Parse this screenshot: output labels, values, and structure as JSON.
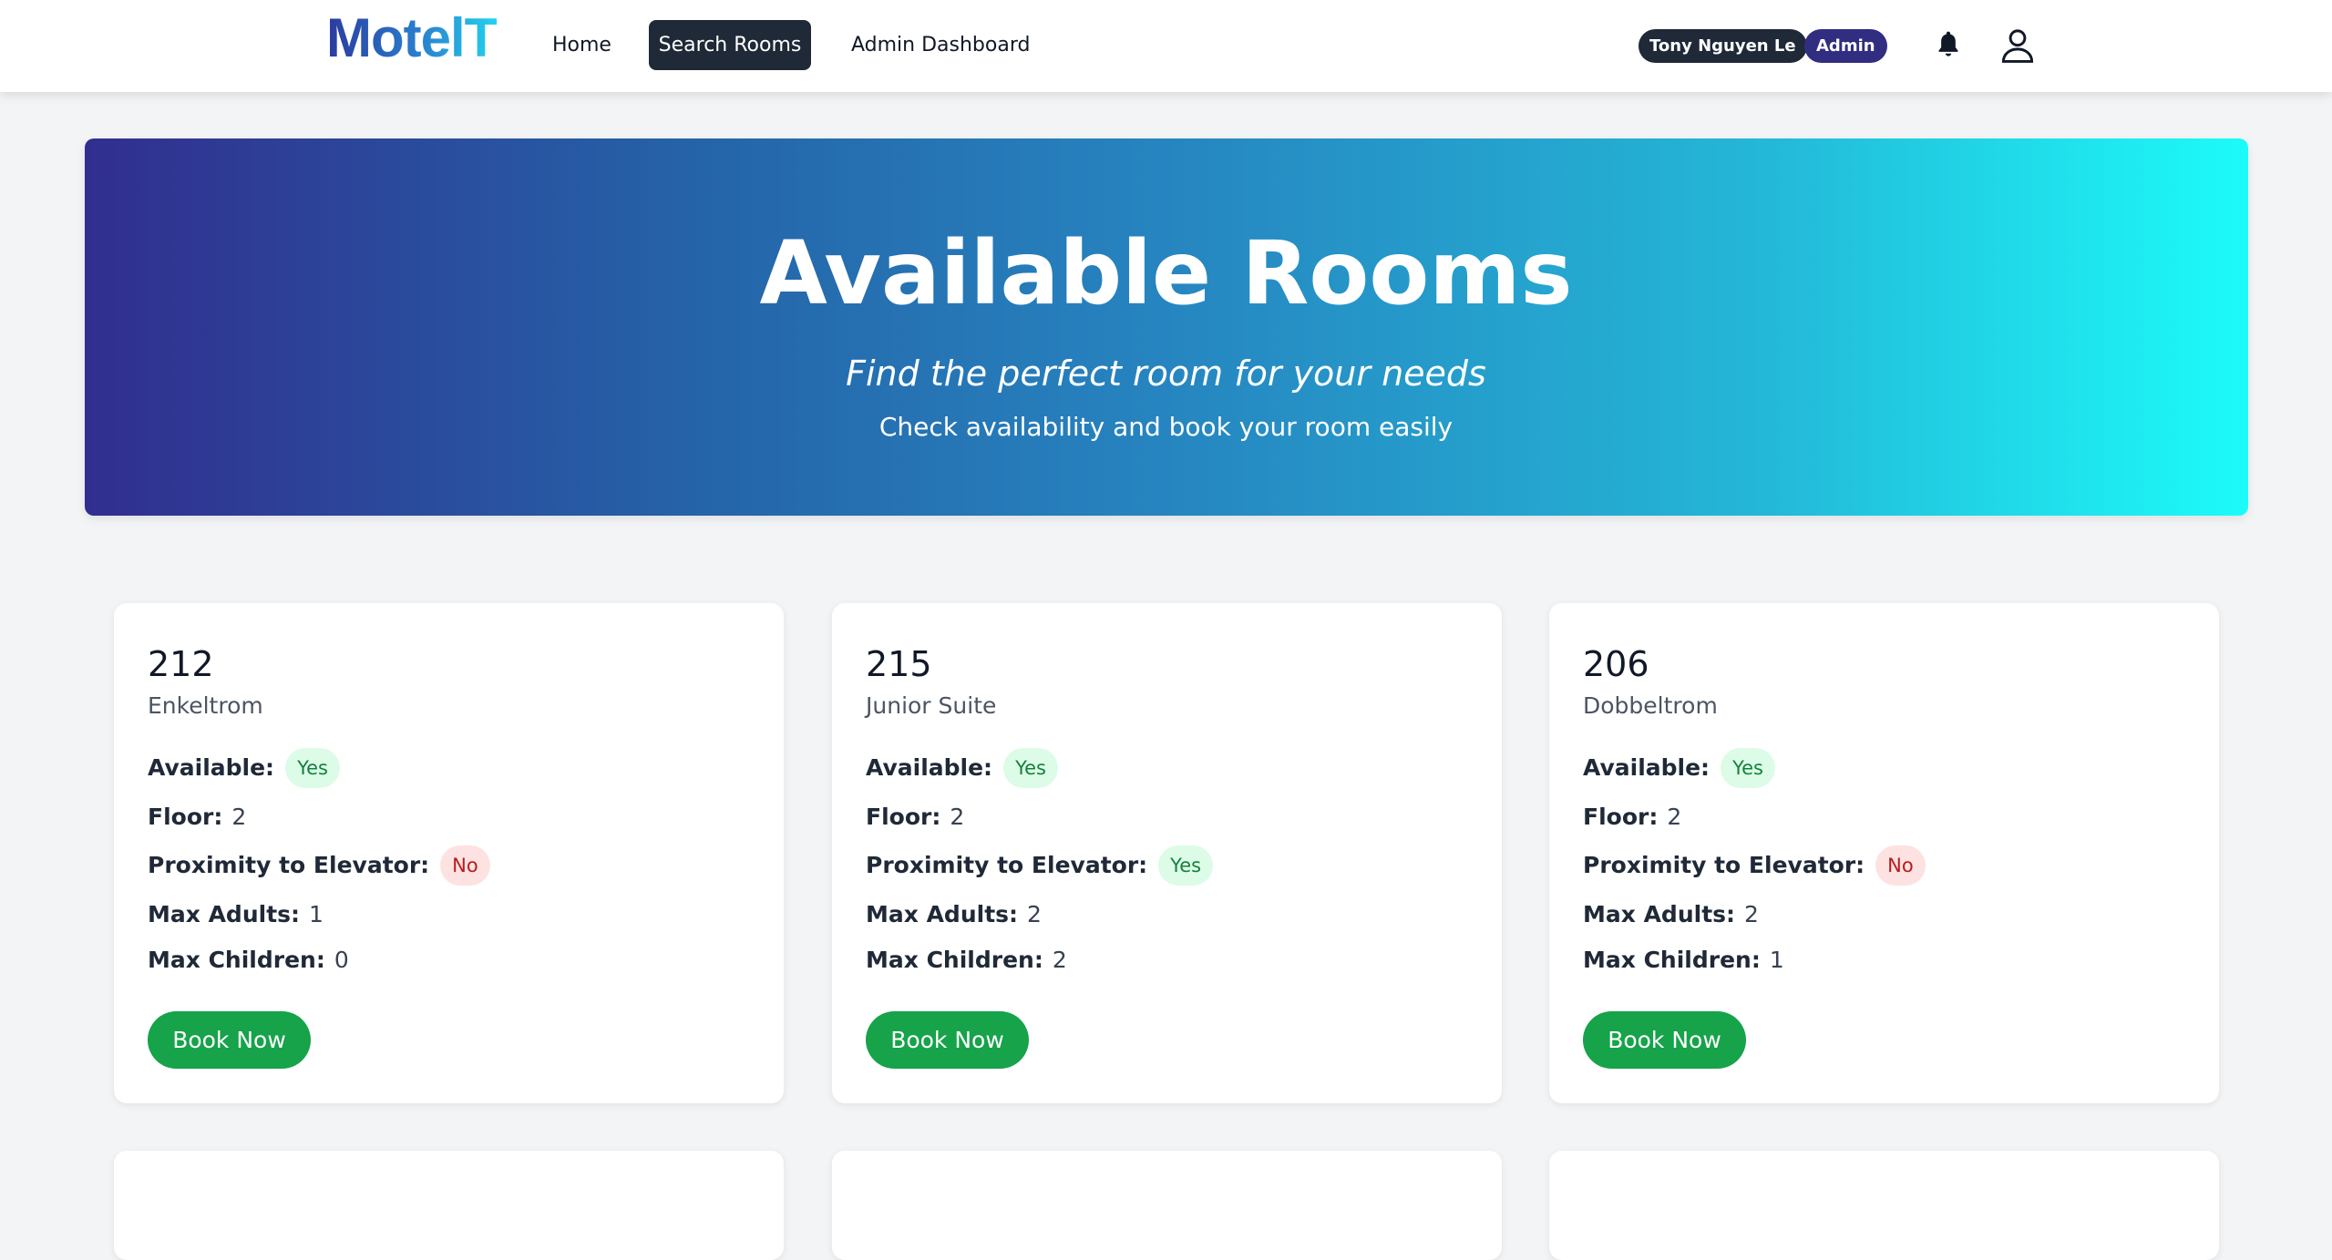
{
  "nav": {
    "logo": "MotelT",
    "home": "Home",
    "search_rooms": "Search Rooms",
    "admin_dashboard": "Admin Dashboard",
    "user_name": "Tony Nguyen Le",
    "role": "Admin",
    "notification_icon": "bell-icon",
    "profile_icon": "user-icon"
  },
  "hero": {
    "title": "Available Rooms",
    "subtitle": "Find the perfect room for your needs",
    "text": "Check availability and book your room easily"
  },
  "labels": {
    "available": "Available:",
    "floor": "Floor:",
    "elevator": "Proximity to Elevator:",
    "max_adults": "Max Adults:",
    "max_children": "Max Children:",
    "book": "Book Now"
  },
  "rooms": [
    {
      "number": "212",
      "type": "Enkeltrom",
      "available": "Yes",
      "floor": "2",
      "elevator": "No",
      "max_adults": "1",
      "max_children": "0"
    },
    {
      "number": "215",
      "type": "Junior Suite",
      "available": "Yes",
      "floor": "2",
      "elevator": "Yes",
      "max_adults": "2",
      "max_children": "2"
    },
    {
      "number": "206",
      "type": "Dobbeltrom",
      "available": "Yes",
      "floor": "2",
      "elevator": "No",
      "max_adults": "2",
      "max_children": "1"
    }
  ],
  "colors": {
    "brand_dark": "#312e81",
    "accent_green": "#16a34a",
    "yes_bg": "#dcfce7",
    "no_bg": "#fee2e2"
  }
}
